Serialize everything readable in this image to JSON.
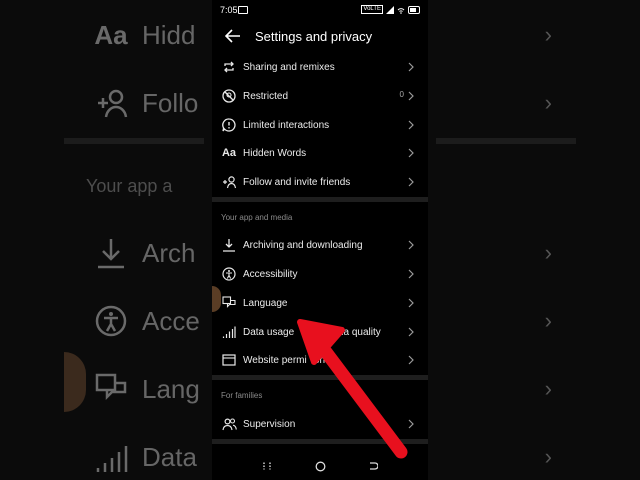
{
  "status_bar": {
    "time": "7:05",
    "volume_badge": "VoLTE"
  },
  "header": {
    "title": "Settings and privacy"
  },
  "items_top": [
    {
      "label": "Sharing and remixes",
      "icon": "remix-icon"
    },
    {
      "label": "Restricted",
      "icon": "restricted-icon",
      "count": "0"
    },
    {
      "label": "Limited interactions",
      "icon": "limited-icon"
    },
    {
      "label": "Hidden Words",
      "icon": "hidden-words-icon",
      "glyph": "Aa"
    },
    {
      "label": "Follow and invite friends",
      "icon": "follow-icon"
    }
  ],
  "section_app_media": {
    "title": "Your app and media"
  },
  "items_app": [
    {
      "label": "Archiving and downloading",
      "icon": "download-icon"
    },
    {
      "label": "Accessibility",
      "icon": "accessibility-icon"
    },
    {
      "label": "Language",
      "icon": "language-icon"
    },
    {
      "label": "Data usage and media quality",
      "icon": "signal-icon",
      "visible_text_1": "Data usage",
      "visible_text_2": "edia quality"
    },
    {
      "label": "Website permissions",
      "icon": "web-icon",
      "visible_text": "Website permi",
      "visible_tail": "ions"
    }
  ],
  "section_families": {
    "title": "For families"
  },
  "items_family": [
    {
      "label": "Supervision",
      "icon": "supervision-icon"
    }
  ],
  "background": {
    "rows": [
      "Hidd",
      "Follo",
      "Arch",
      "Acce",
      "Lang",
      "Data"
    ],
    "section": "Your app a"
  },
  "colors": {
    "arrow": "#e8101e",
    "background": "#000000"
  }
}
